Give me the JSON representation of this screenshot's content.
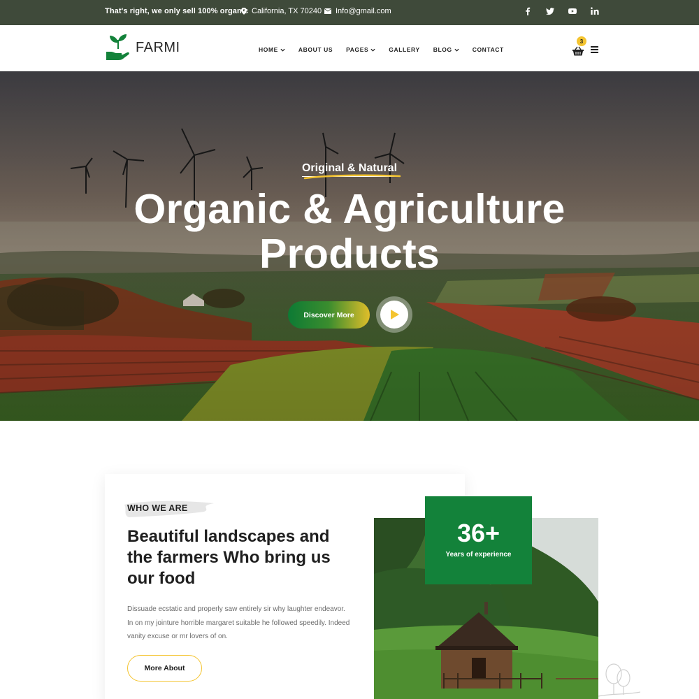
{
  "topbar": {
    "tagline": "That's right, we only sell 100% organic",
    "location": "California, TX 70240",
    "email": "Info@gmail.com",
    "socials": [
      "facebook-icon",
      "twitter-icon",
      "youtube-icon",
      "linkedin-icon"
    ]
  },
  "nav": {
    "logo_text": "FARMI",
    "items": [
      {
        "label": "HOME",
        "dropdown": true
      },
      {
        "label": "ABOUT US",
        "dropdown": false
      },
      {
        "label": "PAGES",
        "dropdown": true
      },
      {
        "label": "GALLERY",
        "dropdown": false
      },
      {
        "label": "BLOG",
        "dropdown": true
      },
      {
        "label": "CONTACT",
        "dropdown": false
      }
    ],
    "cart_count": "3"
  },
  "hero": {
    "eyebrow": "Original & Natural",
    "title_line1": "Organic & Agriculture",
    "title_line2": "Products",
    "cta_label": "Discover More"
  },
  "about": {
    "label": "WHO WE ARE",
    "heading": "Beautiful landscapes and the farmers Who bring us our food",
    "text": "Dissuade ecstatic and properly saw entirely sir why laughter endeavor. In on my jointure horrible margaret suitable he followed speedily. Indeed vanity excuse or mr lovers of on.",
    "button_label": "More About",
    "experience_number": "36+",
    "experience_label": "Years of experience"
  },
  "colors": {
    "topbar_bg": "#3f4a3a",
    "brand_green": "#13823a",
    "accent_yellow": "#f4c430"
  }
}
